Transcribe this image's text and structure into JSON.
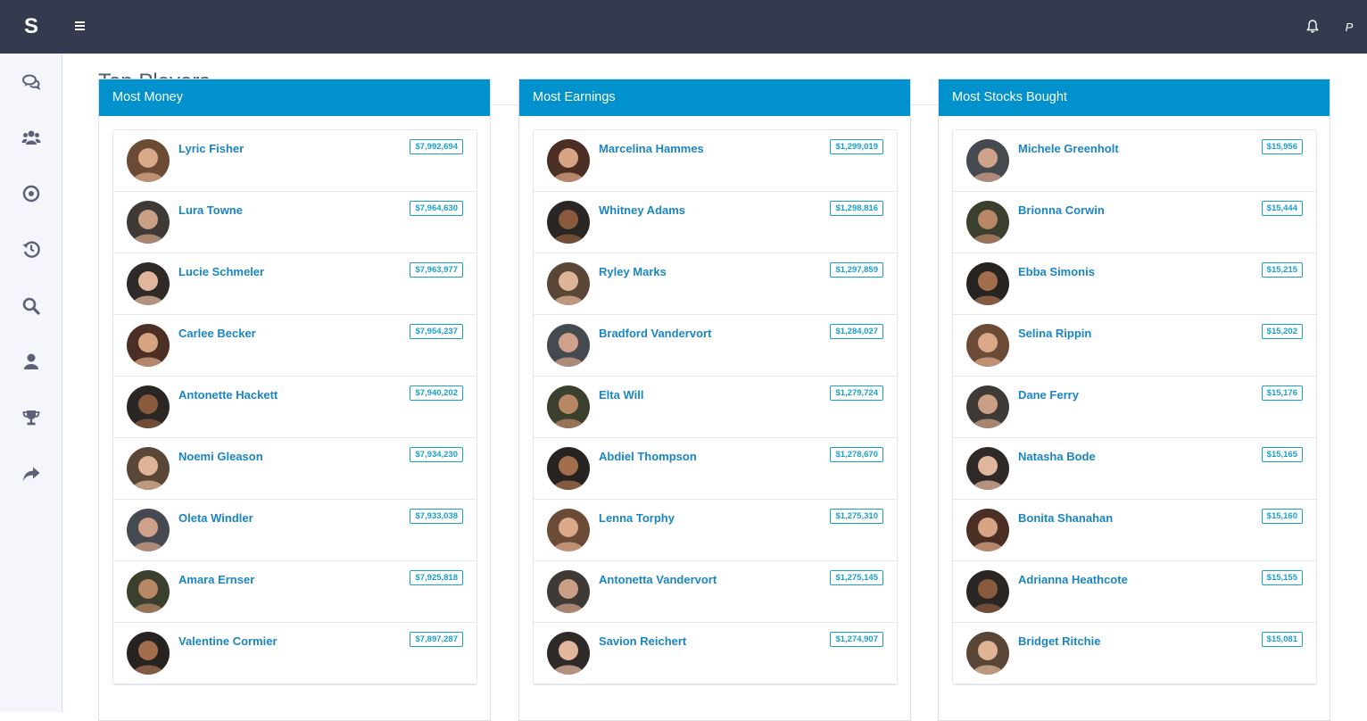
{
  "app": {
    "brand": "S",
    "page_title": "Top Players"
  },
  "sidebar": {
    "items": [
      {
        "icon": "comments-icon",
        "name": "sidebar-item-chat"
      },
      {
        "icon": "users-icon",
        "name": "sidebar-item-users"
      },
      {
        "icon": "target-icon",
        "name": "sidebar-item-target"
      },
      {
        "icon": "history-icon",
        "name": "sidebar-item-history"
      },
      {
        "icon": "search-icon",
        "name": "sidebar-item-search"
      },
      {
        "icon": "user-icon",
        "name": "sidebar-item-profile"
      },
      {
        "icon": "trophy-icon",
        "name": "sidebar-item-trophy"
      },
      {
        "icon": "share-icon",
        "name": "sidebar-item-share"
      }
    ]
  },
  "header": {
    "menu_icon": "hamburger-icon",
    "bell_icon": "bell-icon",
    "p_mark": "P"
  },
  "colors": {
    "topbar": "#353b4f",
    "panel_heading": "#0191cd",
    "link": "#1a85c4",
    "badge": "#1aa0c8"
  },
  "panels": [
    {
      "title": "Most Money",
      "rows": [
        {
          "name": "Lyric Fisher",
          "value": "$7,992,694"
        },
        {
          "name": "Lura Towne",
          "value": "$7,964,630"
        },
        {
          "name": "Lucie Schmeler",
          "value": "$7,963,977"
        },
        {
          "name": "Carlee Becker",
          "value": "$7,954,237"
        },
        {
          "name": "Antonette Hackett",
          "value": "$7,940,202"
        },
        {
          "name": "Noemi Gleason",
          "value": "$7,934,230"
        },
        {
          "name": "Oleta Windler",
          "value": "$7,933,038"
        },
        {
          "name": "Amara Ernser",
          "value": "$7,925,818"
        },
        {
          "name": "Valentine Cormier",
          "value": "$7,897,287"
        }
      ]
    },
    {
      "title": "Most Earnings",
      "rows": [
        {
          "name": "Marcelina Hammes",
          "value": "$1,299,019"
        },
        {
          "name": "Whitney Adams",
          "value": "$1,298,816"
        },
        {
          "name": "Ryley Marks",
          "value": "$1,297,859"
        },
        {
          "name": "Bradford Vandervort",
          "value": "$1,284,027"
        },
        {
          "name": "Elta Will",
          "value": "$1,279,724"
        },
        {
          "name": "Abdiel Thompson",
          "value": "$1,278,670"
        },
        {
          "name": "Lenna Torphy",
          "value": "$1,275,310"
        },
        {
          "name": "Antonetta Vandervort",
          "value": "$1,275,145"
        },
        {
          "name": "Savion Reichert",
          "value": "$1,274,907"
        }
      ]
    },
    {
      "title": "Most Stocks Bought",
      "rows": [
        {
          "name": "Michele Greenholt",
          "value": "$15,956"
        },
        {
          "name": "Brionna Corwin",
          "value": "$15,444"
        },
        {
          "name": "Ebba Simonis",
          "value": "$15,215"
        },
        {
          "name": "Selina Rippin",
          "value": "$15,202"
        },
        {
          "name": "Dane Ferry",
          "value": "$15,176"
        },
        {
          "name": "Natasha Bode",
          "value": "$15,165"
        },
        {
          "name": "Bonita Shanahan",
          "value": "$15,160"
        },
        {
          "name": "Adrianna Heathcote",
          "value": "$15,155"
        },
        {
          "name": "Bridget Ritchie",
          "value": "$15,081"
        }
      ]
    }
  ]
}
